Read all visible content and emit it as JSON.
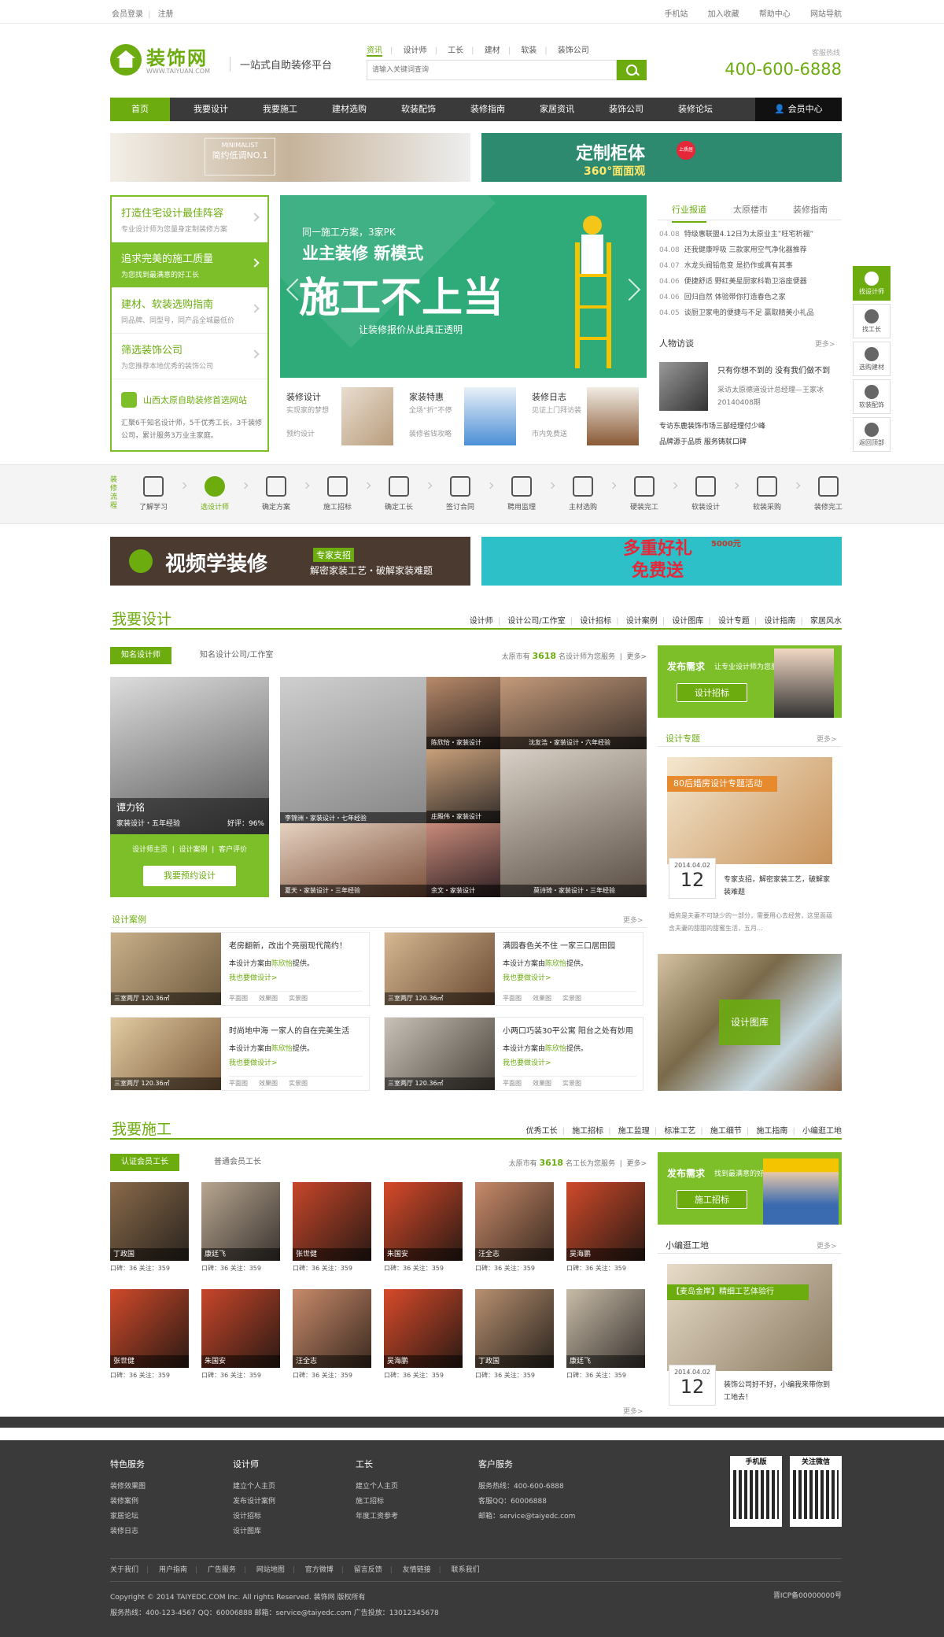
{
  "top": {
    "login": "会员登录",
    "register": "注册",
    "right": [
      "手机站",
      "加入收藏",
      "帮助中心",
      "网站导航"
    ]
  },
  "logo": {
    "title": "装饰网",
    "sub": "WWW.TAIYUAN.COM",
    "slogan": "一站式自助装修平台"
  },
  "search": {
    "tabs": [
      "资讯",
      "设计师",
      "工长",
      "建材",
      "软装",
      "装饰公司"
    ],
    "placeholder": "请输入关键词查询"
  },
  "hotline": {
    "label": "客服热线",
    "number": "400-600-6888"
  },
  "nav": {
    "items": [
      "首页",
      "我要设计",
      "我要施工",
      "建材选购",
      "软装配饰",
      "装修指南",
      "家居资讯",
      "装饰公司",
      "装修论坛"
    ],
    "member": "会员中心"
  },
  "banner1": {
    "t1": "简约低调NO.1",
    "t2": "MINIMALIST"
  },
  "banner2": {
    "t": "定制柜体",
    "s": "360°面面观",
    "badge": "上质居"
  },
  "leftmenu": [
    {
      "t": "打造住宅设计最佳阵容",
      "s": "专业设计师为您量身定制装修方案"
    },
    {
      "t": "追求完美的施工质量",
      "s": "为您找到最满意的好工长"
    },
    {
      "t": "建材、软装选购指南",
      "s": "同品牌、同型号，同产品全城最低价"
    },
    {
      "t": "筛选装饰公司",
      "s": "为您推荐本地优秀的装饰公司"
    },
    {
      "t": "山西太原自助装修首选网站",
      "s": "汇聚6千知名设计师，5千优秀工长，3千装修公司，累计服务3万业主家庭。"
    }
  ],
  "hero": {
    "t1": "同一施工方案，3家PK",
    "t2": "业主装修 新模式",
    "t3": "施工不上当",
    "t4": "让装修报价从此真正透明"
  },
  "cat3": [
    {
      "t": "装修设计",
      "s": "实现家的梦想",
      "s2": "预约设计"
    },
    {
      "t": "家装特惠",
      "s": "全场“折”不停",
      "s2": "装修省钱攻略"
    },
    {
      "t": "装修日志",
      "s": "见证上门拜访装",
      "s2": "市内免费送"
    }
  ],
  "rtabs": [
    "行业报道",
    "太原楼市",
    "装修指南"
  ],
  "news": [
    {
      "d": "04.08",
      "t": "特级惠联盟4.12日为太原业主”旺宅析福”"
    },
    {
      "d": "04.08",
      "t": "还我健康呼吸 三款家用空气净化器推荐"
    },
    {
      "d": "04.07",
      "t": "水龙头阀铅危变 是扔作或真有其事"
    },
    {
      "d": "04.06",
      "t": "便捷舒适 野红美星厨家科勒卫浴座便器"
    },
    {
      "d": "04.06",
      "t": "回归自然 体验带你打造春色之家"
    },
    {
      "d": "04.05",
      "t": "谈厨卫家电的便捷与不足 赢取精美小礼品"
    }
  ],
  "people": {
    "title": "人物访谈",
    "more": "更多>",
    "quote": "只有你想不到的 没有我们做不到",
    "desc": "采访太原德道设计总经理—王家冰",
    "date": "20140408期",
    "l1": "专访东鹿装饰市场三部经理付少峰",
    "l2": "品牌源于品质 服务铸就口碑"
  },
  "sidebar": [
    "找设计师",
    "找工长",
    "选购建材",
    "软装配饰",
    "返回顶部"
  ],
  "flow": {
    "title": "装修流程",
    "steps": [
      "了解学习",
      "选设计师",
      "确定方案",
      "施工招标",
      "确定工长",
      "签订合同",
      "聘用监理",
      "主材选购",
      "硬装完工",
      "软装设计",
      "软装采购",
      "装修完工"
    ]
  },
  "bn3": {
    "t": "视频学装修",
    "tag": "专家支招",
    "s": "解密家装工艺・破解家装难题"
  },
  "bn4": {
    "t1": "多重好礼",
    "t2": "免费送",
    "badge": "5000元"
  },
  "design": {
    "title": "我要设计",
    "links": [
      "设计师",
      "设计公司/工作室",
      "设计招标",
      "设计案例",
      "设计图库",
      "设计专题",
      "设计指南",
      "家居风水"
    ],
    "tab_on": "知名设计师",
    "tab_off": "知名设计公司/工作室",
    "cnt_pre": "太原市有",
    "cnt": "3618",
    "cnt_post": "名设计师为您服务",
    "more": "更多>"
  },
  "featured": {
    "name": "谭力铭",
    "info": "家装设计・五年经验",
    "rate": "好评：96%",
    "links": [
      "设计师主页",
      "设计案例",
      "客户评价"
    ],
    "btn": "我要预约设计"
  },
  "designers": [
    "李锦洲・家装设计・七年经验",
    "陈欣怡・家装设计",
    "沈友浩・家装设计・六年经验",
    "庄殿伟・家装设计",
    "夏天・家装设计・三年经验",
    "余文・家装设计",
    "莫诗琦・家装设计・三年经验"
  ],
  "post1": {
    "t1": "发布需求",
    "t2": "让专业设计师为您服务",
    "btn": "设计招标"
  },
  "topic": {
    "title": "设计专题",
    "more": "更多>",
    "img": "80后婚房设计专题活动",
    "date": "2014.04.02",
    "day": "12",
    "t": "专家支招，解密家装工艺，破解家装难题",
    "desc": "婚房是夫妻不可缺少的一部分，需要用心去经营，这里面蕴含夫妻的甜甜的甜蜜生活，五月..."
  },
  "cases": {
    "title": "设计案例",
    "more": "更多>",
    "items": [
      {
        "t": "老房翻新，改出个亮丽现代简约！",
        "by": "本设计方案由",
        "name": "陈欣怡",
        "suf": "提供。",
        "link": "我也要做设计>",
        "cap": "三室两厅  120.36㎡"
      },
      {
        "t": "满园春色关不住 一家三口居田园",
        "by": "本设计方案由",
        "name": "陈欣怡",
        "suf": "提供。",
        "link": "我也要做设计>",
        "cap": "三室两厅  120.36㎡"
      },
      {
        "t": "时尚地中海 一家人的自在完美生活",
        "by": "本设计方案由",
        "name": "陈欣怡",
        "suf": "提供。",
        "link": "我也要做设计>",
        "cap": "三室两厅  120.36㎡"
      },
      {
        "t": "小两口巧装30平公寓 阳台之处有妙用",
        "by": "本设计方案由",
        "name": "陈欣怡",
        "suf": "提供。",
        "link": "我也要做设计>",
        "cap": "三室两厅  120.36㎡"
      }
    ],
    "sub": [
      "平面图",
      "效果图",
      "实景图"
    ]
  },
  "gallery": "设计图库",
  "build": {
    "title": "我要施工",
    "links": [
      "优秀工长",
      "施工招标",
      "施工监理",
      "标准工艺",
      "施工细节",
      "施工指南",
      "小编逛工地"
    ],
    "tab_on": "认证会员工长",
    "tab_off": "普通会员工长",
    "cnt_pre": "太原市有",
    "cnt": "3618",
    "cnt_post": "名工长为您服务",
    "more": "更多>"
  },
  "workers": [
    {
      "n": "丁政国",
      "s": "口碑：36    关注：359"
    },
    {
      "n": "康廷飞",
      "s": "口碑：36    关注：359"
    },
    {
      "n": "张世健",
      "s": "口碑：36    关注：359"
    },
    {
      "n": "朱国安",
      "s": "口碑：36    关注：359"
    },
    {
      "n": "汪全志",
      "s": "口碑：36    关注：359"
    },
    {
      "n": "吴海鹏",
      "s": "口碑：36    关注：359"
    },
    {
      "n": "张世健",
      "s": "口碑：36    关注：359"
    },
    {
      "n": "朱国安",
      "s": "口碑：36    关注：359"
    },
    {
      "n": "汪全志",
      "s": "口碑：36    关注：359"
    },
    {
      "n": "吴海鹏",
      "s": "口碑：36    关注：359"
    },
    {
      "n": "丁政国",
      "s": "口碑：36    关注：359"
    },
    {
      "n": "康廷飞",
      "s": "口碑：36    关注：359"
    }
  ],
  "post2": {
    "t1": "发布需求",
    "t2": "找到最满意的好工长",
    "btn": "施工招标"
  },
  "site": {
    "title": "小编逛工地",
    "more": "更多>",
    "img": "【麦岛金岸】精细工艺体验行",
    "date": "2014.04.02",
    "day": "12",
    "t": "装饰公司好不好，小编我来带你到工地去！"
  },
  "footer": {
    "cols": [
      {
        "h": "特色服务",
        "i": [
          "装修效果图",
          "装修案例",
          "家居论坛",
          "装修日志"
        ]
      },
      {
        "h": "设计师",
        "i": [
          "建立个人主页",
          "发布设计案例",
          "设计招标",
          "设计图库"
        ]
      },
      {
        "h": "工长",
        "i": [
          "建立个人主页",
          "施工招标",
          "年度工资参考"
        ]
      },
      {
        "h": "客户服务",
        "i": [
          "服务热线：400-600-6888",
          "客服QQ：60006888",
          "邮箱：service@taiyedc.com"
        ]
      }
    ],
    "qr": [
      "手机版",
      "关注微信"
    ],
    "links": [
      "关于我们",
      "用户指南",
      "广告服务",
      "网站地图",
      "官方微博",
      "留言反馈",
      "友情链接",
      "联系我们"
    ],
    "copy1": "Copyright © 2014 TAIYEDC.COM Inc. All rights Reserved.   装饰网 版权所有",
    "copy2": "服务热线：400-123-4567   QQ：60006888   邮箱：service@taiyedc.com   广告投放：13012345678",
    "icp": "晋ICP备00000000号"
  },
  "colors": {
    "brand": "#6cac0f",
    "nav": "#3a3a3a",
    "footer": "#3a3a3a"
  }
}
